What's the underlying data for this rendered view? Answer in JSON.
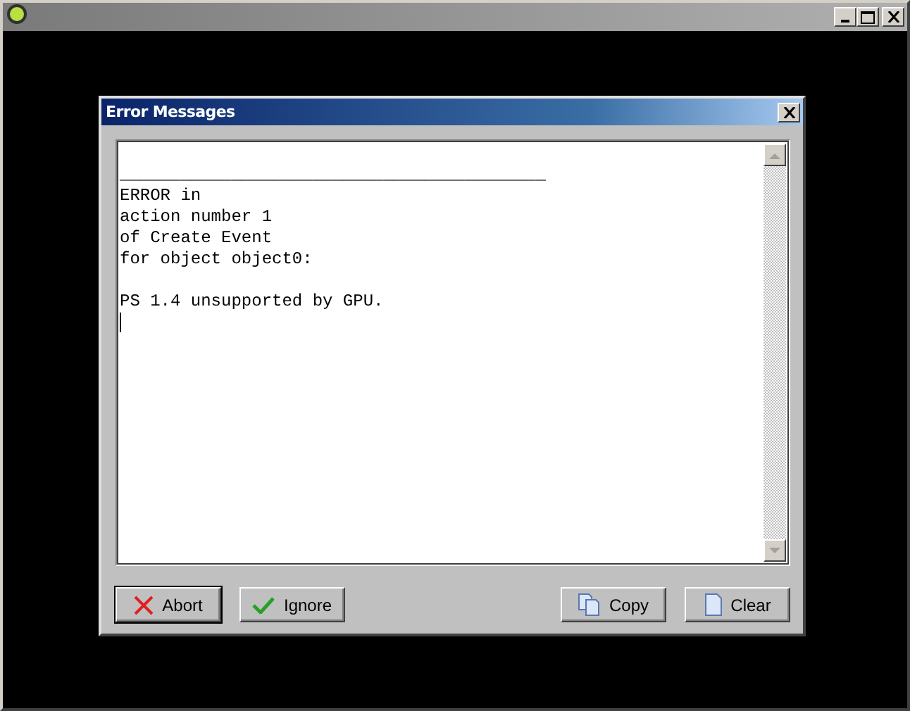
{
  "window": {
    "title_icon": true
  },
  "dialog": {
    "title": "Error Messages",
    "text": "\n__________________________________________\nERROR in\naction number 1\nof Create Event\nfor object object0:\n\nPS 1.4 unsupported by GPU.\n",
    "caret": true,
    "left_buttons": [
      {
        "label": "Abort",
        "kind": "cross",
        "default": true
      },
      {
        "label": "Ignore",
        "kind": "check",
        "default": false
      }
    ],
    "right_buttons": [
      {
        "label": "Copy",
        "kind": "copy",
        "default": false
      },
      {
        "label": "Clear",
        "kind": "page",
        "default": false
      }
    ]
  }
}
